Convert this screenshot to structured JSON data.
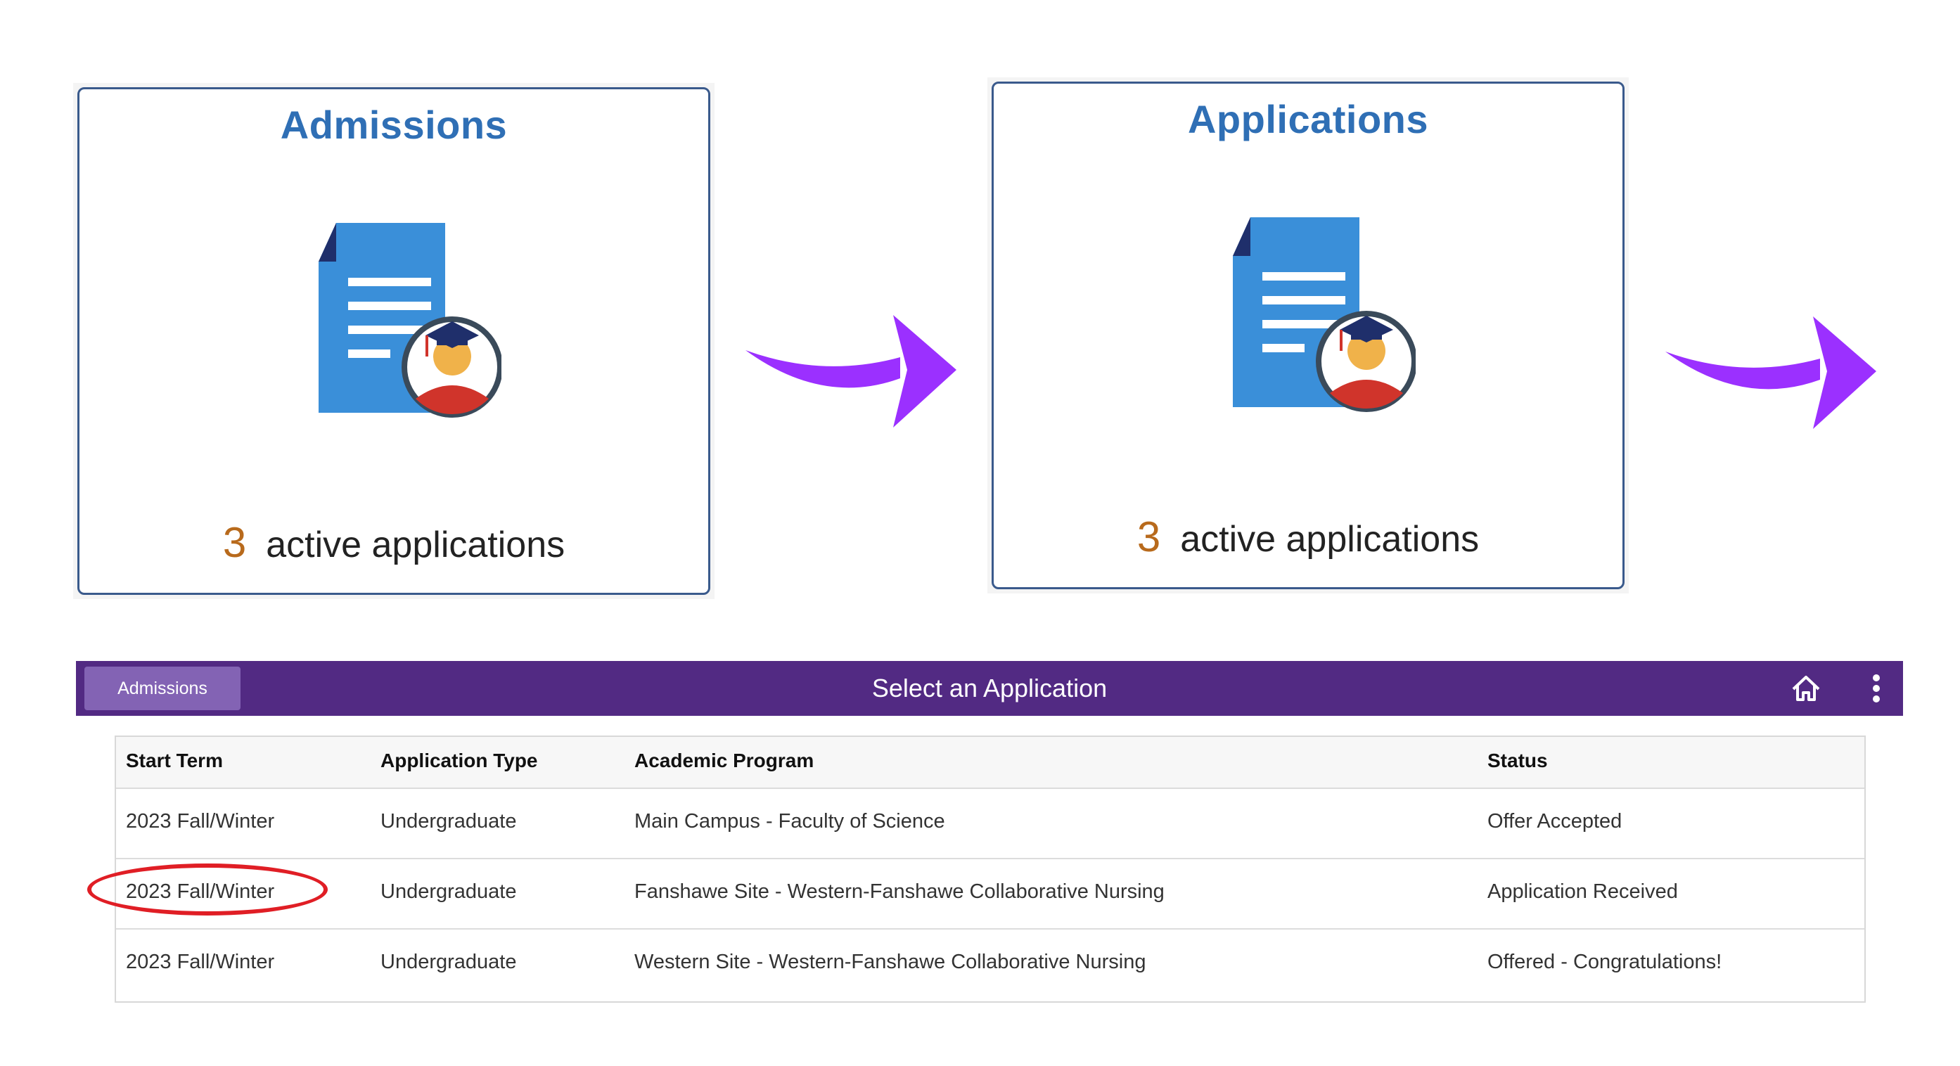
{
  "tiles": [
    {
      "title": "Admissions",
      "count": "3",
      "count_label": "active applications",
      "icon": "document-graduate-icon"
    },
    {
      "title": "Applications",
      "count": "3",
      "count_label": "active applications",
      "icon": "document-graduate-icon"
    }
  ],
  "arrow_color": "#9b30ff",
  "header_bar": {
    "button_label": "Admissions",
    "title": "Select an Application",
    "home_icon": "home-icon",
    "menu_icon": "kebab-menu-icon",
    "color": "#522a83"
  },
  "table": {
    "columns": [
      "Start Term",
      "Application Type",
      "Academic Program",
      "Status"
    ],
    "rows": [
      [
        "2023 Fall/Winter",
        "Undergraduate",
        "Main Campus - Faculty of Science",
        "Offer Accepted"
      ],
      [
        "2023 Fall/Winter",
        "Undergraduate",
        "Fanshawe Site - Western-Fanshawe Collaborative Nursing",
        "Application Received"
      ],
      [
        "2023 Fall/Winter",
        "Undergraduate",
        "Western Site - Western-Fanshawe Collaborative Nursing",
        "Offered - Congratulations!"
      ]
    ]
  },
  "highlight_color": "#e01e25"
}
